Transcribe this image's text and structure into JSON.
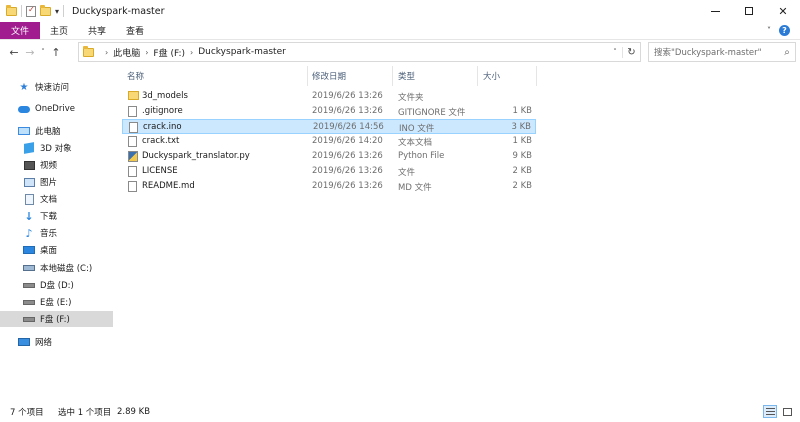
{
  "window": {
    "title": "Duckyspark-master",
    "quick_access_dropdown": "▾",
    "controls": {
      "close": "✕"
    }
  },
  "ribbon": {
    "tabs": [
      "文件",
      "主页",
      "共享",
      "查看"
    ],
    "collapse": "˅",
    "help": "?"
  },
  "nav": {
    "back": "←",
    "forward": "→",
    "recent": "˅",
    "up": "↑"
  },
  "address": {
    "crumbs": [
      "此电脑",
      "F盘 (F:)",
      "Duckyspark-master"
    ],
    "separator": "›",
    "dropdown": "˅",
    "refresh": "↻"
  },
  "search": {
    "placeholder": "搜索\"Duckyspark-master\"",
    "icon": "⌕"
  },
  "sidebar": {
    "items": [
      {
        "label": "快速访问",
        "icon": "star-icon"
      },
      {
        "label": "OneDrive",
        "icon": "cloud-icon"
      },
      {
        "label": "此电脑",
        "icon": "computer-icon"
      },
      {
        "label": "3D 对象",
        "icon": "3d-objects-icon"
      },
      {
        "label": "视频",
        "icon": "video-icon"
      },
      {
        "label": "图片",
        "icon": "pictures-icon"
      },
      {
        "label": "文档",
        "icon": "documents-icon"
      },
      {
        "label": "下载",
        "icon": "download-icon"
      },
      {
        "label": "音乐",
        "icon": "music-icon"
      },
      {
        "label": "桌面",
        "icon": "desktop-icon"
      },
      {
        "label": "本地磁盘 (C:)",
        "icon": "drive-icon"
      },
      {
        "label": "D盘 (D:)",
        "icon": "drive-icon"
      },
      {
        "label": "E盘 (E:)",
        "icon": "drive-icon"
      },
      {
        "label": "F盘 (F:)",
        "icon": "drive-icon",
        "selected": true
      },
      {
        "label": "网络",
        "icon": "network-icon"
      }
    ],
    "glyphs": {
      "star": "★",
      "download": "↓",
      "music": "♪"
    }
  },
  "columns": {
    "name": "名称",
    "date": "修改日期",
    "type": "类型",
    "size": "大小"
  },
  "files": [
    {
      "name": "3d_models",
      "date": "2019/6/26 13:26",
      "type": "文件夹",
      "size": "",
      "icon": "folder-icon"
    },
    {
      "name": ".gitignore",
      "date": "2019/6/26 13:26",
      "type": "GITIGNORE 文件",
      "size": "1 KB",
      "icon": "file-icon"
    },
    {
      "name": "crack.ino",
      "date": "2019/6/26 14:56",
      "type": "INO 文件",
      "size": "3 KB",
      "icon": "file-icon",
      "selected": true
    },
    {
      "name": "crack.txt",
      "date": "2019/6/26 14:20",
      "type": "文本文档",
      "size": "1 KB",
      "icon": "file-icon"
    },
    {
      "name": "Duckyspark_translator.py",
      "date": "2019/6/26 13:26",
      "type": "Python File",
      "size": "9 KB",
      "icon": "python-file-icon"
    },
    {
      "name": "LICENSE",
      "date": "2019/6/26 13:26",
      "type": "文件",
      "size": "2 KB",
      "icon": "file-icon"
    },
    {
      "name": "README.md",
      "date": "2019/6/26 13:26",
      "type": "MD 文件",
      "size": "2 KB",
      "icon": "file-icon"
    }
  ],
  "status": {
    "count": "7 个项目",
    "selected": "选中 1 个项目",
    "size": "2.89 KB"
  },
  "colors": {
    "file_tab": "#a01c8f",
    "selection": "#cce8ff",
    "selection_border": "#99d1ff",
    "sidebar_selected": "#d9d9d9"
  }
}
